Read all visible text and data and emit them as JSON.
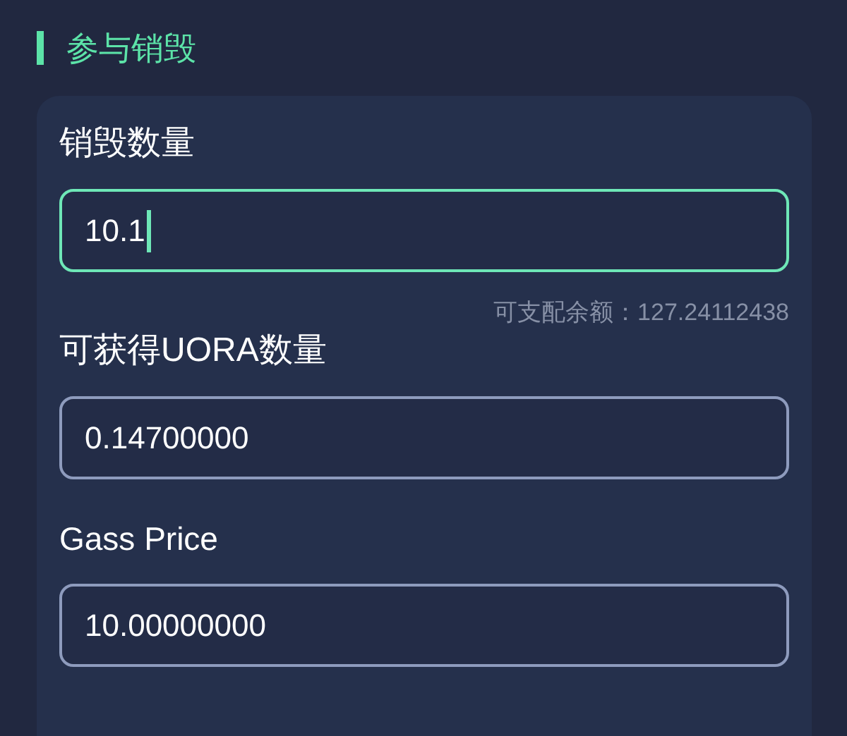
{
  "section": {
    "title": "参与销毁"
  },
  "form": {
    "fields": [
      {
        "label": "销毁数量",
        "value": "10.1",
        "focused": true,
        "hint": "可支配余额：127.24112438"
      },
      {
        "label": "可获得UORA数量",
        "value": "0.14700000",
        "focused": false
      },
      {
        "label": "Gass Price",
        "value": "10.00000000",
        "focused": false
      }
    ]
  }
}
